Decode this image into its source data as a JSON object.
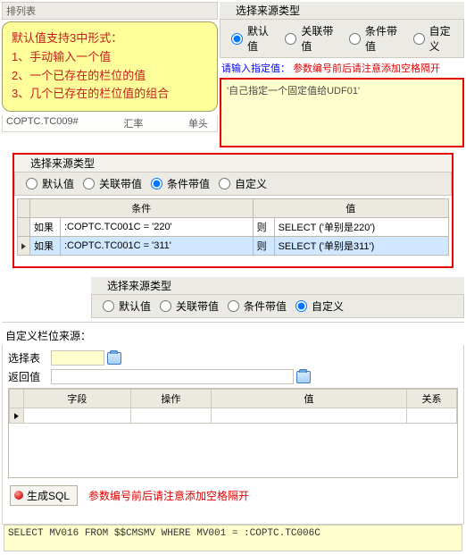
{
  "sec1": {
    "left_header": "排列表",
    "callout": {
      "line1": "默认值支持3中形式：",
      "line2": "1、手动输入一个值",
      "line3": "2、一个已存在的栏位的值",
      "line4": "3、几个已存在的栏位值的组合"
    },
    "grid_rows": [
      {
        "col1": "COPTC.TC009#",
        "col2": "汇率",
        "col3": "单头"
      }
    ],
    "right_header": "选择来源类型",
    "radios": [
      "默认值",
      "关联带值",
      "条件带值",
      "自定义"
    ],
    "hint_prefix": "请输入指定值：",
    "hint_red": "参数编号前后请注意添加空格隔开",
    "yellow_text": "'自己指定一个固定值给UDF01'"
  },
  "sec2": {
    "header": "选择来源类型",
    "radios": [
      "默认值",
      "关联带值",
      "条件带值",
      "自定义"
    ],
    "selected": "条件带值",
    "cols": {
      "cond": "条件",
      "val": "值"
    },
    "rows": [
      {
        "if": "如果",
        "cond": ":COPTC.TC001C = '220'",
        "then": "则",
        "val": "SELECT ('单别是220')",
        "sel": false
      },
      {
        "if": "如果",
        "cond": ":COPTC.TC001C = '311'",
        "then": "则",
        "val": "SELECT ('单别是311')",
        "sel": true
      }
    ]
  },
  "sec3": {
    "header": "选择来源类型",
    "radios": [
      "默认值",
      "关联带值",
      "条件带值",
      "自定义"
    ],
    "selected": "自定义",
    "body_title": "自定义栏位来源：",
    "select_table": "选择表",
    "return_value": "返回值",
    "cols": [
      "字段",
      "操作",
      "值",
      "关系"
    ],
    "gen_btn": "生成SQL",
    "hint_red": "参数编号前后请注意添加空格隔开",
    "sql": "SELECT MV016 FROM $$CMSMV WHERE MV001 =  :COPTC.TC006C"
  }
}
